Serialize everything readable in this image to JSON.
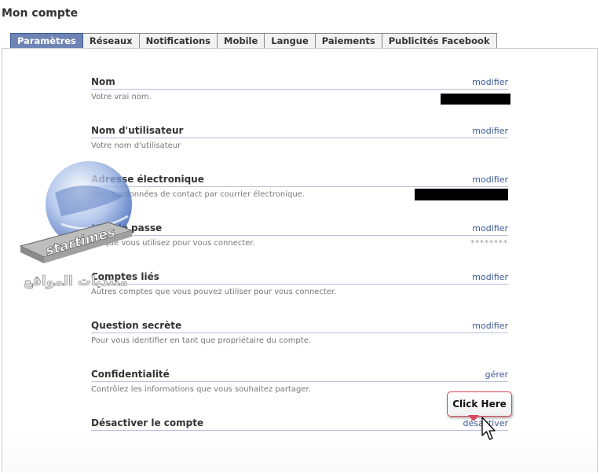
{
  "page_title": "Mon compte",
  "tabs": [
    {
      "label": "Paramètres",
      "active": true
    },
    {
      "label": "Réseaux"
    },
    {
      "label": "Notifications"
    },
    {
      "label": "Mobile"
    },
    {
      "label": "Langue"
    },
    {
      "label": "Paiements"
    },
    {
      "label": "Publicités Facebook"
    }
  ],
  "sections": [
    {
      "label": "Nom",
      "action": "modifier",
      "description": "Votre vrai nom."
    },
    {
      "label": "Nom d'utilisateur",
      "action": "modifier",
      "description": "Votre nom d'utilisateur"
    },
    {
      "label": "Adresse électronique",
      "action": "modifier",
      "description": "Vos coordonnées de contact par courrier électronique."
    },
    {
      "label": "Mot de passe",
      "action": "modifier",
      "description": "Ce que vous utilisez pour vous connecter.",
      "value": "********"
    },
    {
      "label": "Comptes liés",
      "action": "modifier",
      "description": "Autres comptes que vous pouvez utiliser pour vous connecter."
    },
    {
      "label": "Question secrète",
      "action": "modifier",
      "description": "Pour vous identifier en tant que propriétaire du compte."
    },
    {
      "label": "Confidentialité",
      "action": "gérer",
      "description": "Contrôlez les informations que vous souhaitez partager."
    },
    {
      "label": "Désactiver le compte",
      "action": "désactiver",
      "description": ""
    }
  ],
  "callout": {
    "label": "Click Here"
  },
  "watermark": {
    "text": "startimes"
  },
  "colors": {
    "accent": "#3b5998",
    "active_tab": "#6d84b4",
    "callout_border": "#d9485a"
  },
  "icons": [
    "globe-watermark-icon",
    "pointer-cursor-icon"
  ]
}
